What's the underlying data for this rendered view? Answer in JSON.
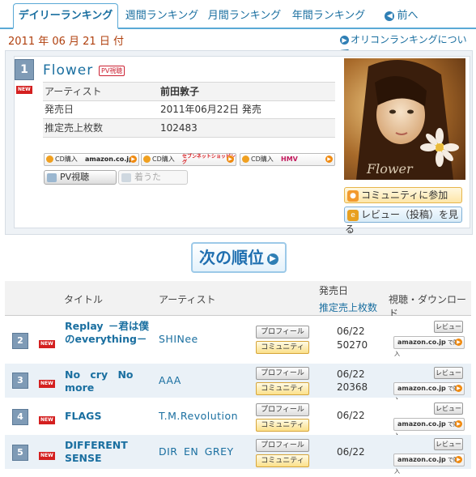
{
  "tabs": [
    {
      "label": "デイリーランキング",
      "active": true
    },
    {
      "label": "週間ランキング",
      "active": false
    },
    {
      "label": "月間ランキング",
      "active": false
    },
    {
      "label": "年間ランキング",
      "active": false
    },
    {
      "label": "前へ",
      "active": false
    }
  ],
  "date_label": "2011 年 06 月 21 日 付",
  "oricon_link": "オリコンランキングについて",
  "feature": {
    "rank": "1",
    "new_label": "NEW",
    "title": "Flower",
    "pv_badge": "PV視聴",
    "rows": [
      {
        "key": "アーティスト",
        "value": "前田敦子"
      },
      {
        "key": "発売日",
        "value": "2011年06月22日 発売"
      },
      {
        "key": "推定売上枚数",
        "value": "102483"
      }
    ],
    "cd_buttons": [
      {
        "label": "CD購入",
        "store": "amazon.co.jp"
      },
      {
        "label": "CD購入",
        "store": "セブンネットショッピング"
      },
      {
        "label": "CD購入",
        "store": "HMV"
      }
    ],
    "pv_button": "PV視聴",
    "chaku_button": "着うた",
    "jacket_text": "Flower",
    "community_button": "コミュニティに参加",
    "review_button": "レビュー（投稿）を見る"
  },
  "next_rank_label": "次の順位",
  "table": {
    "headers": {
      "title": "タイトル",
      "artist": "アーティスト",
      "release": "発売日",
      "sales": "推定売上枚数",
      "listen": "視聴・ダウンロード"
    },
    "profile_label": "プロフィール",
    "community_label": "コミュニティ",
    "review_label": "レビュー",
    "amazon_label": "amazon.co.jp",
    "amazon_action": "で購入",
    "rows": [
      {
        "rank": "2",
        "new": "NEW",
        "title": "Replay －君は僕のeverything－",
        "artist": "SHINee",
        "date": "06/22",
        "sales": "50270"
      },
      {
        "rank": "3",
        "new": "NEW",
        "title": "No cry No more",
        "artist": "AAA",
        "date": "06/22",
        "sales": "20368"
      },
      {
        "rank": "4",
        "new": "NEW",
        "title": "FLAGS",
        "artist": "T.M.Revolution",
        "date": "06/22",
        "sales": ""
      },
      {
        "rank": "5",
        "new": "NEW",
        "title": "DIFFERENT SENSE",
        "artist": "DIR EN GREY",
        "date": "06/22",
        "sales": ""
      }
    ]
  },
  "colors": {
    "accent": "#1a6fa0",
    "rank_badge": "#7f9bb6",
    "new_badge": "#d42020",
    "date_text": "#b0400e"
  }
}
